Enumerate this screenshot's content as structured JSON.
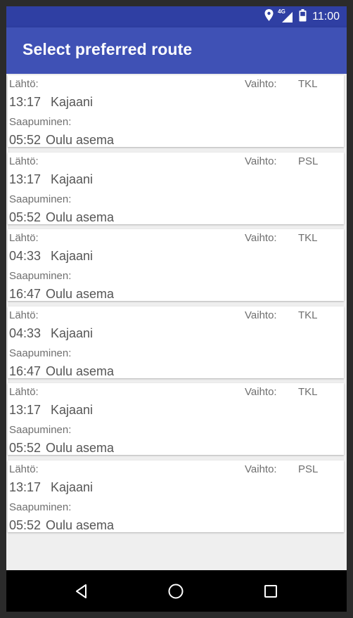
{
  "status_bar": {
    "time": "11:00",
    "network": "4G",
    "icons": [
      "location-icon",
      "signal-4g-icon",
      "battery-icon"
    ]
  },
  "app_bar": {
    "title": "Select preferred route"
  },
  "routes": [
    {
      "depart_label": "Lähtö:",
      "depart_time": "13:17",
      "depart_station": "Kajaani",
      "change_label": "Vaihto:",
      "change_station": "TKL",
      "arrive_label": "Saapuminen:",
      "arrive_time": "05:52",
      "arrive_station": "Oulu asema"
    },
    {
      "depart_label": "Lähtö:",
      "depart_time": "13:17",
      "depart_station": "Kajaani",
      "change_label": "Vaihto:",
      "change_station": "PSL",
      "arrive_label": "Saapuminen:",
      "arrive_time": "05:52",
      "arrive_station": "Oulu asema"
    },
    {
      "depart_label": "Lähtö:",
      "depart_time": "04:33",
      "depart_station": "Kajaani",
      "change_label": "Vaihto:",
      "change_station": "TKL",
      "arrive_label": "Saapuminen:",
      "arrive_time": "16:47",
      "arrive_station": "Oulu asema"
    },
    {
      "depart_label": "Lähtö:",
      "depart_time": "04:33",
      "depart_station": "Kajaani",
      "change_label": "Vaihto:",
      "change_station": "TKL",
      "arrive_label": "Saapuminen:",
      "arrive_time": "16:47",
      "arrive_station": "Oulu asema"
    },
    {
      "depart_label": "Lähtö:",
      "depart_time": "13:17",
      "depart_station": "Kajaani",
      "change_label": "Vaihto:",
      "change_station": "TKL",
      "arrive_label": "Saapuminen:",
      "arrive_time": "05:52",
      "arrive_station": "Oulu asema"
    },
    {
      "depart_label": "Lähtö:",
      "depart_time": "13:17",
      "depart_station": "Kajaani",
      "change_label": "Vaihto:",
      "change_station": "PSL",
      "arrive_label": "Saapuminen:",
      "arrive_time": "05:52",
      "arrive_station": "Oulu asema"
    }
  ],
  "nav_bar": {
    "buttons": [
      "back-icon",
      "home-icon",
      "recents-icon"
    ]
  },
  "colors": {
    "primary": "#3f51b5",
    "primary_dark": "#2f3fa3",
    "background": "#efefef"
  }
}
